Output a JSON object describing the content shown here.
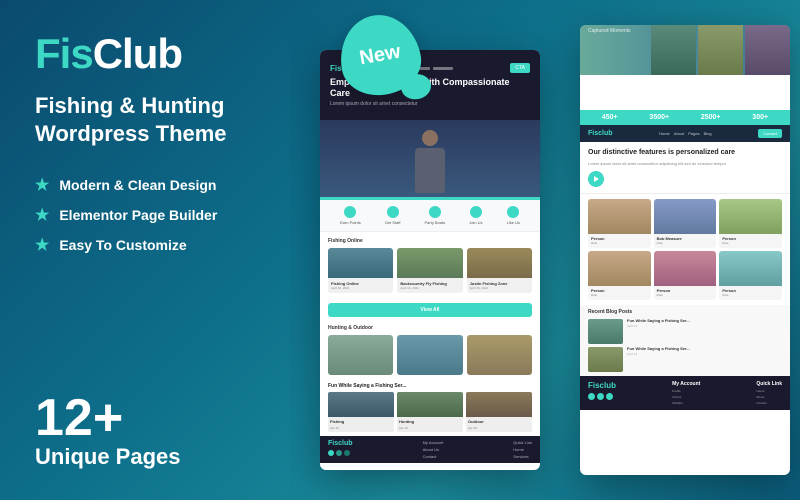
{
  "badge": {
    "label": "New"
  },
  "hero": {
    "logo": {
      "part1": "Fis",
      "part2": "Club"
    },
    "tagline_line1": "Fishing & Hunting",
    "tagline_line2": "Wordpress Theme",
    "features": [
      {
        "label": "Modern & Clean Design"
      },
      {
        "label": "Elementor Page Builder"
      },
      {
        "label": "Easy To Customize"
      }
    ],
    "pages_count": "12+",
    "pages_label": "Unique Pages"
  },
  "mockup_left": {
    "logo": "Fisclub",
    "hero_title": "Empowering Seniors with Compassionate Care",
    "icons": [
      "Earn Points",
      "Get Staff",
      "Party Boats",
      "Join Us",
      "Like Us"
    ],
    "cards_title": "Fishing Online",
    "cards": [
      {
        "title": "Fishing Online",
        "sub": "April 16, 2021"
      },
      {
        "title": "Backcountry Fly Fishing",
        "sub": "April 16, 2021"
      },
      {
        "title": "Justin Fishing Zone",
        "sub": "April 16, 2021"
      }
    ],
    "more_cards_title": "Hunting & Outdoor",
    "blog_section": "Fun While Saying a Fishing Ser...",
    "footer_logo": "Fisclub"
  },
  "mockup_right": {
    "top_label": "Captured Moments",
    "stats": [
      {
        "num": "450+",
        "label": ""
      },
      {
        "num": "3500+",
        "label": ""
      },
      {
        "num": "2500+",
        "label": ""
      },
      {
        "num": "300+",
        "label": ""
      }
    ],
    "feature_title": "Our distinctive features is personalized care",
    "nav_logo": "Fisclub",
    "people": [
      {
        "name": "Person",
        "role": "Role"
      },
      {
        "name": "Bob Measure",
        "role": "Role"
      },
      {
        "name": "Person",
        "role": "Role"
      },
      {
        "name": "Person",
        "role": "Role"
      },
      {
        "name": "Person",
        "role": "Role"
      },
      {
        "name": "Person",
        "role": "Role"
      }
    ],
    "blog": [
      {
        "title": "Fun While Saying a Fishing Ser...",
        "sub": "April 13"
      },
      {
        "title": "Fun While Saying a Fishing Ser...",
        "sub": "April 13"
      }
    ],
    "footer_logo": "Fisclub"
  },
  "colors": {
    "teal": "#3dd9c5",
    "dark_bg": "#0a4a6e"
  }
}
